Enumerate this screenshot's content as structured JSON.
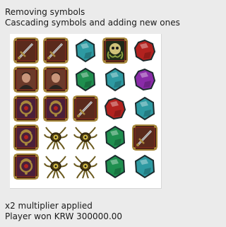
{
  "messages": {
    "removing": "Removing symbols",
    "cascading": "Cascading symbols and adding new ones",
    "multiplier": "x2 multiplier applied",
    "win": "Player won KRW 300000.00"
  },
  "board": {
    "rows": [
      [
        "sword-icon",
        "sword-icon",
        "teal-gem-icon",
        "skull-icon",
        "red-gem-icon"
      ],
      [
        "portrait-icon",
        "portrait-icon",
        "green-gem-icon",
        "teal-gem-icon",
        "purple-gem-icon"
      ],
      [
        "amulet-icon",
        "amulet-icon",
        "sword-icon",
        "red-gem-icon",
        "teal-gem-icon"
      ],
      [
        "amulet-icon",
        "eye-creature-icon",
        "eye-creature-icon",
        "green-gem-icon",
        "sword-icon"
      ],
      [
        "amulet-icon",
        "eye-creature-icon",
        "eye-creature-icon",
        "green-gem-icon",
        "teal-gem-icon"
      ]
    ]
  },
  "colors": {
    "frame_gold": "#a8883c",
    "frame_dark": "#3a1f14",
    "frame_red": "#7d2a1d",
    "gem_teal": "#2e9aa2",
    "gem_red": "#b2221f",
    "gem_green": "#1f8f4f",
    "gem_purple": "#8a2ba8",
    "creature": "#6b5a1e",
    "portrait_skin": "#c9967b"
  }
}
